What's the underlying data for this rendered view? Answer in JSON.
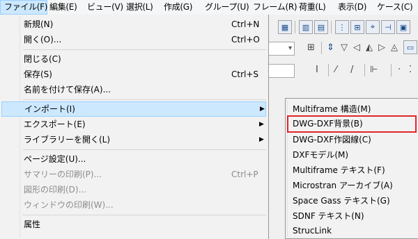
{
  "menubar": {
    "items": [
      {
        "label": "ファイル(F)"
      },
      {
        "label": "編集(E)"
      },
      {
        "label": "ビュー(V)"
      },
      {
        "label": "選択(L)"
      },
      {
        "label": "作成(G)"
      },
      {
        "label": "グループ(U)"
      },
      {
        "label": "フレーム(R)"
      },
      {
        "label": "荷重(L)"
      },
      {
        "label": "表示(D)"
      },
      {
        "label": "ケース(C)"
      }
    ]
  },
  "file_menu": {
    "new": {
      "label": "新規(N)",
      "shortcut": "Ctrl+N"
    },
    "open": {
      "label": "開く(O)...",
      "shortcut": "Ctrl+O"
    },
    "close": {
      "label": "閉じる(C)"
    },
    "save": {
      "label": "保存(S)",
      "shortcut": "Ctrl+S"
    },
    "save_as": {
      "label": "名前を付けて保存(A)..."
    },
    "import": {
      "label": "インポート(I)"
    },
    "export": {
      "label": "エクスポート(E)"
    },
    "open_library": {
      "label": "ライブラリーを開く(L)"
    },
    "page_setup": {
      "label": "ページ設定(U)..."
    },
    "print_summary": {
      "label": "サマリーの印刷(P)...",
      "shortcut": "Ctrl+P"
    },
    "print_figure": {
      "label": "図形の印刷(D)..."
    },
    "print_window": {
      "label": "ウィンドウの印刷(W)..."
    },
    "properties": {
      "label": "属性"
    }
  },
  "import_submenu": {
    "items": [
      {
        "label": "Multiframe 構造(M)"
      },
      {
        "label": "DWG-DXF背景(B)"
      },
      {
        "label": "DWG-DXF作図線(C)"
      },
      {
        "label": "DXFモデル(M)"
      },
      {
        "label": "Multiframe テキスト(F)"
      },
      {
        "label": "Microstran アーカイブ(A)"
      },
      {
        "label": "Space Gass テキスト(G)"
      },
      {
        "label": "SDNF テキスト(N)"
      },
      {
        "label": "StrucLink"
      }
    ]
  },
  "colors": {
    "highlight_box": "#e0262a",
    "hover_bg": "#cce8ff"
  }
}
